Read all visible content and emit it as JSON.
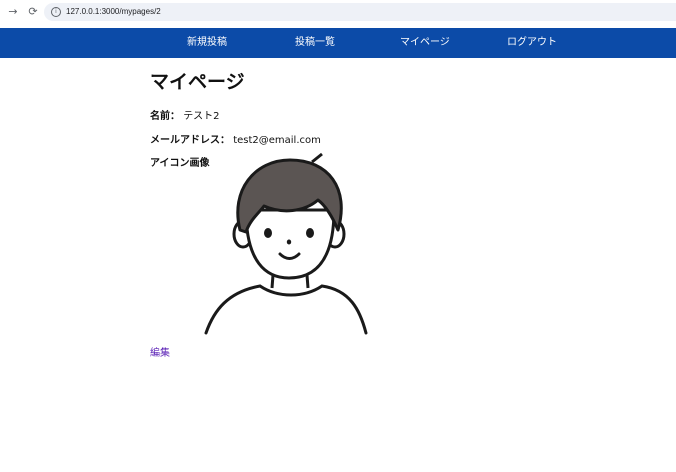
{
  "browser": {
    "url": "127.0.0.1:3000/mypages/2"
  },
  "nav": {
    "items": [
      {
        "label": "新規投稿"
      },
      {
        "label": "投稿一覧"
      },
      {
        "label": "マイページ"
      },
      {
        "label": "ログアウト"
      }
    ]
  },
  "page": {
    "title": "マイページ",
    "name_label": "名前：",
    "name_value": "テスト2",
    "email_label": "メールアドレス：",
    "email_value": "test2@email.com",
    "icon_label": "アイコン画像",
    "edit_link": "編集"
  },
  "colors": {
    "nav_bg": "#0c4ba8",
    "link_visited": "#5b21b6"
  },
  "icons": [
    "back-arrow-icon",
    "reload-icon",
    "site-info-icon"
  ]
}
